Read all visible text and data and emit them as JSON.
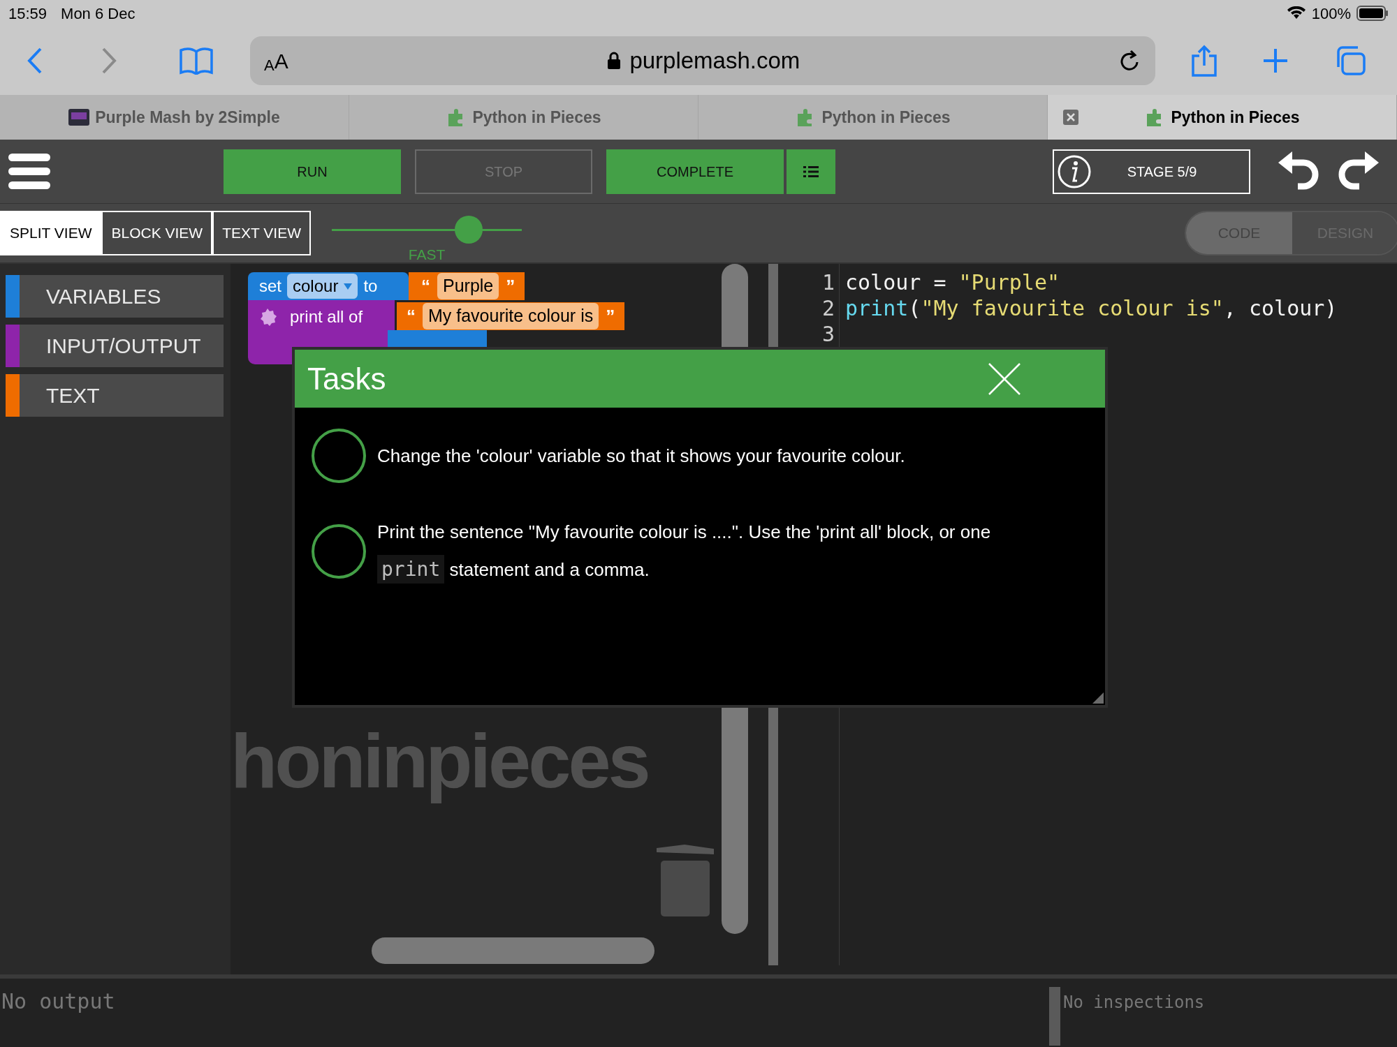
{
  "status_bar": {
    "time": "15:59",
    "date": "Mon 6 Dec",
    "battery": "100%"
  },
  "browser": {
    "text_size": {
      "small": "A",
      "large": "A"
    },
    "url": "purplemash.com",
    "tabs": [
      {
        "title": "Purple Mash by 2Simple",
        "kind": "mash",
        "selected": false
      },
      {
        "title": "Python in Pieces",
        "kind": "python",
        "selected": false
      },
      {
        "title": "Python in Pieces",
        "kind": "python",
        "selected": false
      },
      {
        "title": "Python in Pieces",
        "kind": "python",
        "selected": true
      }
    ]
  },
  "toolbar": {
    "buttons": [
      {
        "label": "RUN",
        "disabled": false
      },
      {
        "label": "STOP",
        "disabled": true
      },
      {
        "label": "COMPLETE",
        "disabled": false
      }
    ],
    "stage": "STAGE 5/9"
  },
  "views": [
    {
      "label": "SPLIT VIEW",
      "selected": true
    },
    {
      "label": "BLOCK VIEW",
      "selected": false
    },
    {
      "label": "TEXT VIEW",
      "selected": false
    }
  ],
  "speed": {
    "level": 0.72,
    "label": "FAST"
  },
  "mode": [
    {
      "label": "CODE",
      "selected": true
    },
    {
      "label": "DESIGN",
      "selected": false
    }
  ],
  "categories": [
    {
      "label": "VARIABLES",
      "color": "#1e7fd8"
    },
    {
      "label": "INPUT/OUTPUT",
      "color": "#8e24aa"
    },
    {
      "label": "TEXT",
      "color": "#ef6c00"
    }
  ],
  "blocks": {
    "set": {
      "keyword": "set",
      "variable": "colour",
      "to": "to",
      "value": "Purple"
    },
    "print": {
      "keyword": "print all of",
      "value": "My favourite colour is"
    },
    "open_quote": "“",
    "close_quote": "”"
  },
  "workspace_logo": "honinpieces",
  "code": [
    {
      "number": "1",
      "tokens": [
        {
          "kind": "plain",
          "text": "colour = "
        },
        {
          "kind": "string",
          "text": "\"Purple\""
        }
      ]
    },
    {
      "number": "2",
      "tokens": [
        {
          "kind": "builtin",
          "text": "print"
        },
        {
          "kind": "plain",
          "text": "("
        },
        {
          "kind": "string",
          "text": "\"My favourite colour is\""
        },
        {
          "kind": "plain",
          "text": ", colour)"
        }
      ]
    },
    {
      "number": "3"
    }
  ],
  "tasks": {
    "title": "Tasks",
    "items": [
      {
        "done": false,
        "parts": [
          {
            "kind": "text",
            "text": "Change the 'colour' variable so that it shows your favourite colour."
          }
        ]
      },
      {
        "done": false,
        "parts": [
          {
            "kind": "text",
            "text": "Print the sentence \"My favourite colour is ....\". Use the 'print all' block, or one "
          },
          {
            "kind": "code",
            "text": "print"
          },
          {
            "kind": "text",
            "text": " statement and a comma."
          }
        ]
      }
    ]
  },
  "output": {
    "placeholder": "No output"
  },
  "inspections": {
    "placeholder": "No inspections"
  }
}
